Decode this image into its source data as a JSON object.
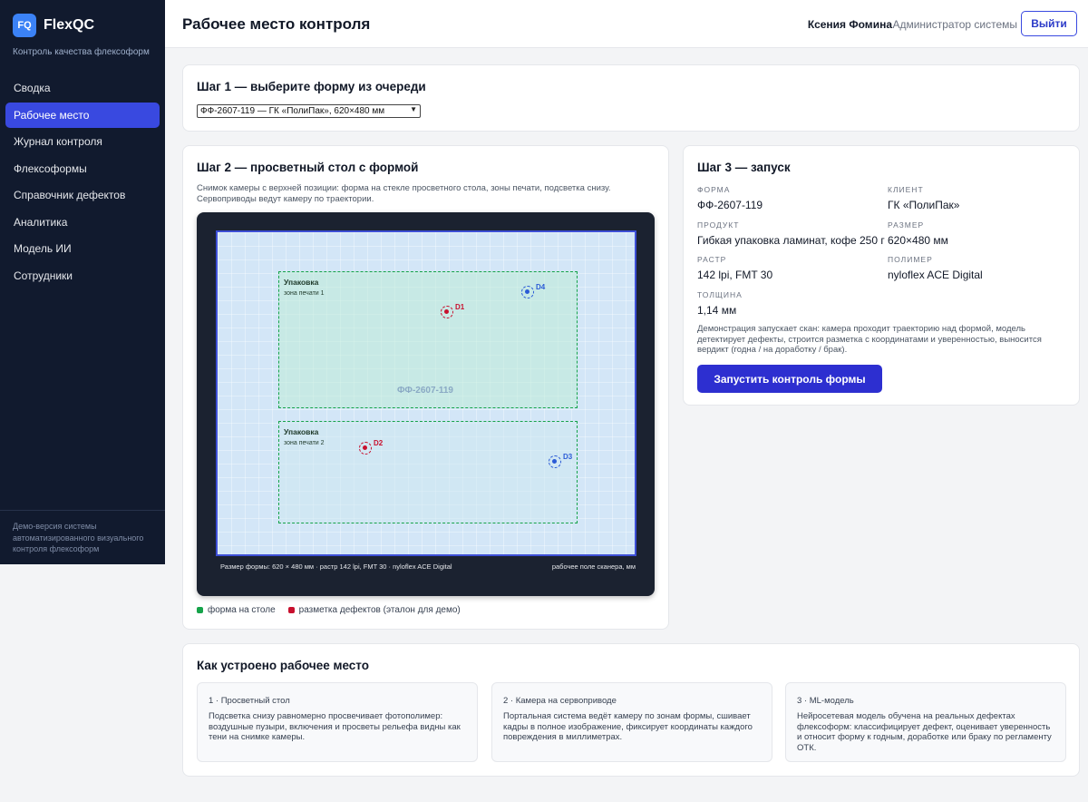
{
  "app": {
    "logo": "FQ",
    "name": "FlexQC",
    "subtitle": "Контроль качества флексоформ",
    "footer": "Демо-версия системы автоматизированного визуального контроля флексоформ"
  },
  "sidebar": {
    "items": [
      {
        "label": "Сводка",
        "active": false
      },
      {
        "label": "Рабочее место",
        "active": true
      },
      {
        "label": "Журнал контроля",
        "active": false
      },
      {
        "label": "Флексоформы",
        "active": false
      },
      {
        "label": "Справочник дефектов",
        "active": false
      },
      {
        "label": "Аналитика",
        "active": false
      },
      {
        "label": "Модель ИИ",
        "active": false
      },
      {
        "label": "Сотрудники",
        "active": false
      }
    ]
  },
  "header": {
    "title": "Рабочее место контроля",
    "user_name": "Ксения Фомина",
    "user_role": "Администратор системы",
    "logout_label": "Выйти"
  },
  "step1": {
    "title": "Шаг 1 — выберите форму из очереди",
    "selected": "ФФ-2607-119 — ГК «ПолиПак», 620×480 мм"
  },
  "step2": {
    "title": "Шаг 2 — просветный стол с формой",
    "description": "Снимок камеры с верхней позиции: форма на стекле просветного стола, зоны печати, подсветка снизу. Сервоприводы ведут камеру по траектории.",
    "zones": [
      {
        "title": "Упаковка",
        "subtitle": "зона печати 1"
      },
      {
        "title": "Упаковка",
        "subtitle": "зона печати 2"
      }
    ],
    "form_label": "ФФ-2607-119",
    "defects": [
      {
        "id": "D1",
        "color": "#c8102e"
      },
      {
        "id": "D2",
        "color": "#c8102e"
      },
      {
        "id": "D3",
        "color": "#2b5bd6"
      },
      {
        "id": "D4",
        "color": "#2b5bd6"
      }
    ],
    "footer_left": "Размер формы: 620 × 480 мм · растр 142 lpi, FMT 30 · nyloflex ACE Digital",
    "footer_right": "рабочее поле сканера, мм",
    "legend": [
      {
        "label": "форма на столе",
        "color": "#16a34a"
      },
      {
        "label": "разметка дефектов (эталон для демо)",
        "color": "#c8102e"
      }
    ]
  },
  "step3": {
    "title": "Шаг 3 — запуск",
    "fields": {
      "form": {
        "label": "Форма",
        "value": "ФФ-2607-119"
      },
      "client": {
        "label": "Клиент",
        "value": "ГК «ПолиПак»"
      },
      "product": {
        "label": "Продукт",
        "value": "Гибкая упаковка ламинат, кофе 250 г"
      },
      "size": {
        "label": "Размер",
        "value": "620×480 мм"
      },
      "raster": {
        "label": "Растр",
        "value": "142 lpi, FMT 30"
      },
      "polymer": {
        "label": "Полимер",
        "value": "nyloflex ACE Digital"
      },
      "thickness": {
        "label": "Толщина",
        "value": "1,14 мм"
      }
    },
    "note": "Демонстрация запускает скан: камера проходит траекторию над формой, модель детектирует дефекты, строится разметка с координатами и уверенностью, выносится вердикт (годна / на доработку / брак).",
    "run_label": "Запустить контроль формы"
  },
  "how": {
    "title": "Как устроено рабочее место",
    "cards": [
      {
        "title": "1 · Просветный стол",
        "text": "Подсветка снизу равномерно просвечивает фотополимер: воздушные пузыри, включения и просветы рельефа видны как тени на снимке камеры."
      },
      {
        "title": "2 · Камера на сервоприводе",
        "text": "Портальная система ведёт камеру по зонам формы, сшивает кадры в полное изображение, фиксирует координаты каждого повреждения в миллиметрах."
      },
      {
        "title": "3 · ML-модель",
        "text": "Нейросетевая модель обучена на реальных дефектах флексоформ: классифицирует дефект, оценивает уверенность и относит форму к годным, доработке или браку по регламенту ОТК."
      }
    ]
  }
}
